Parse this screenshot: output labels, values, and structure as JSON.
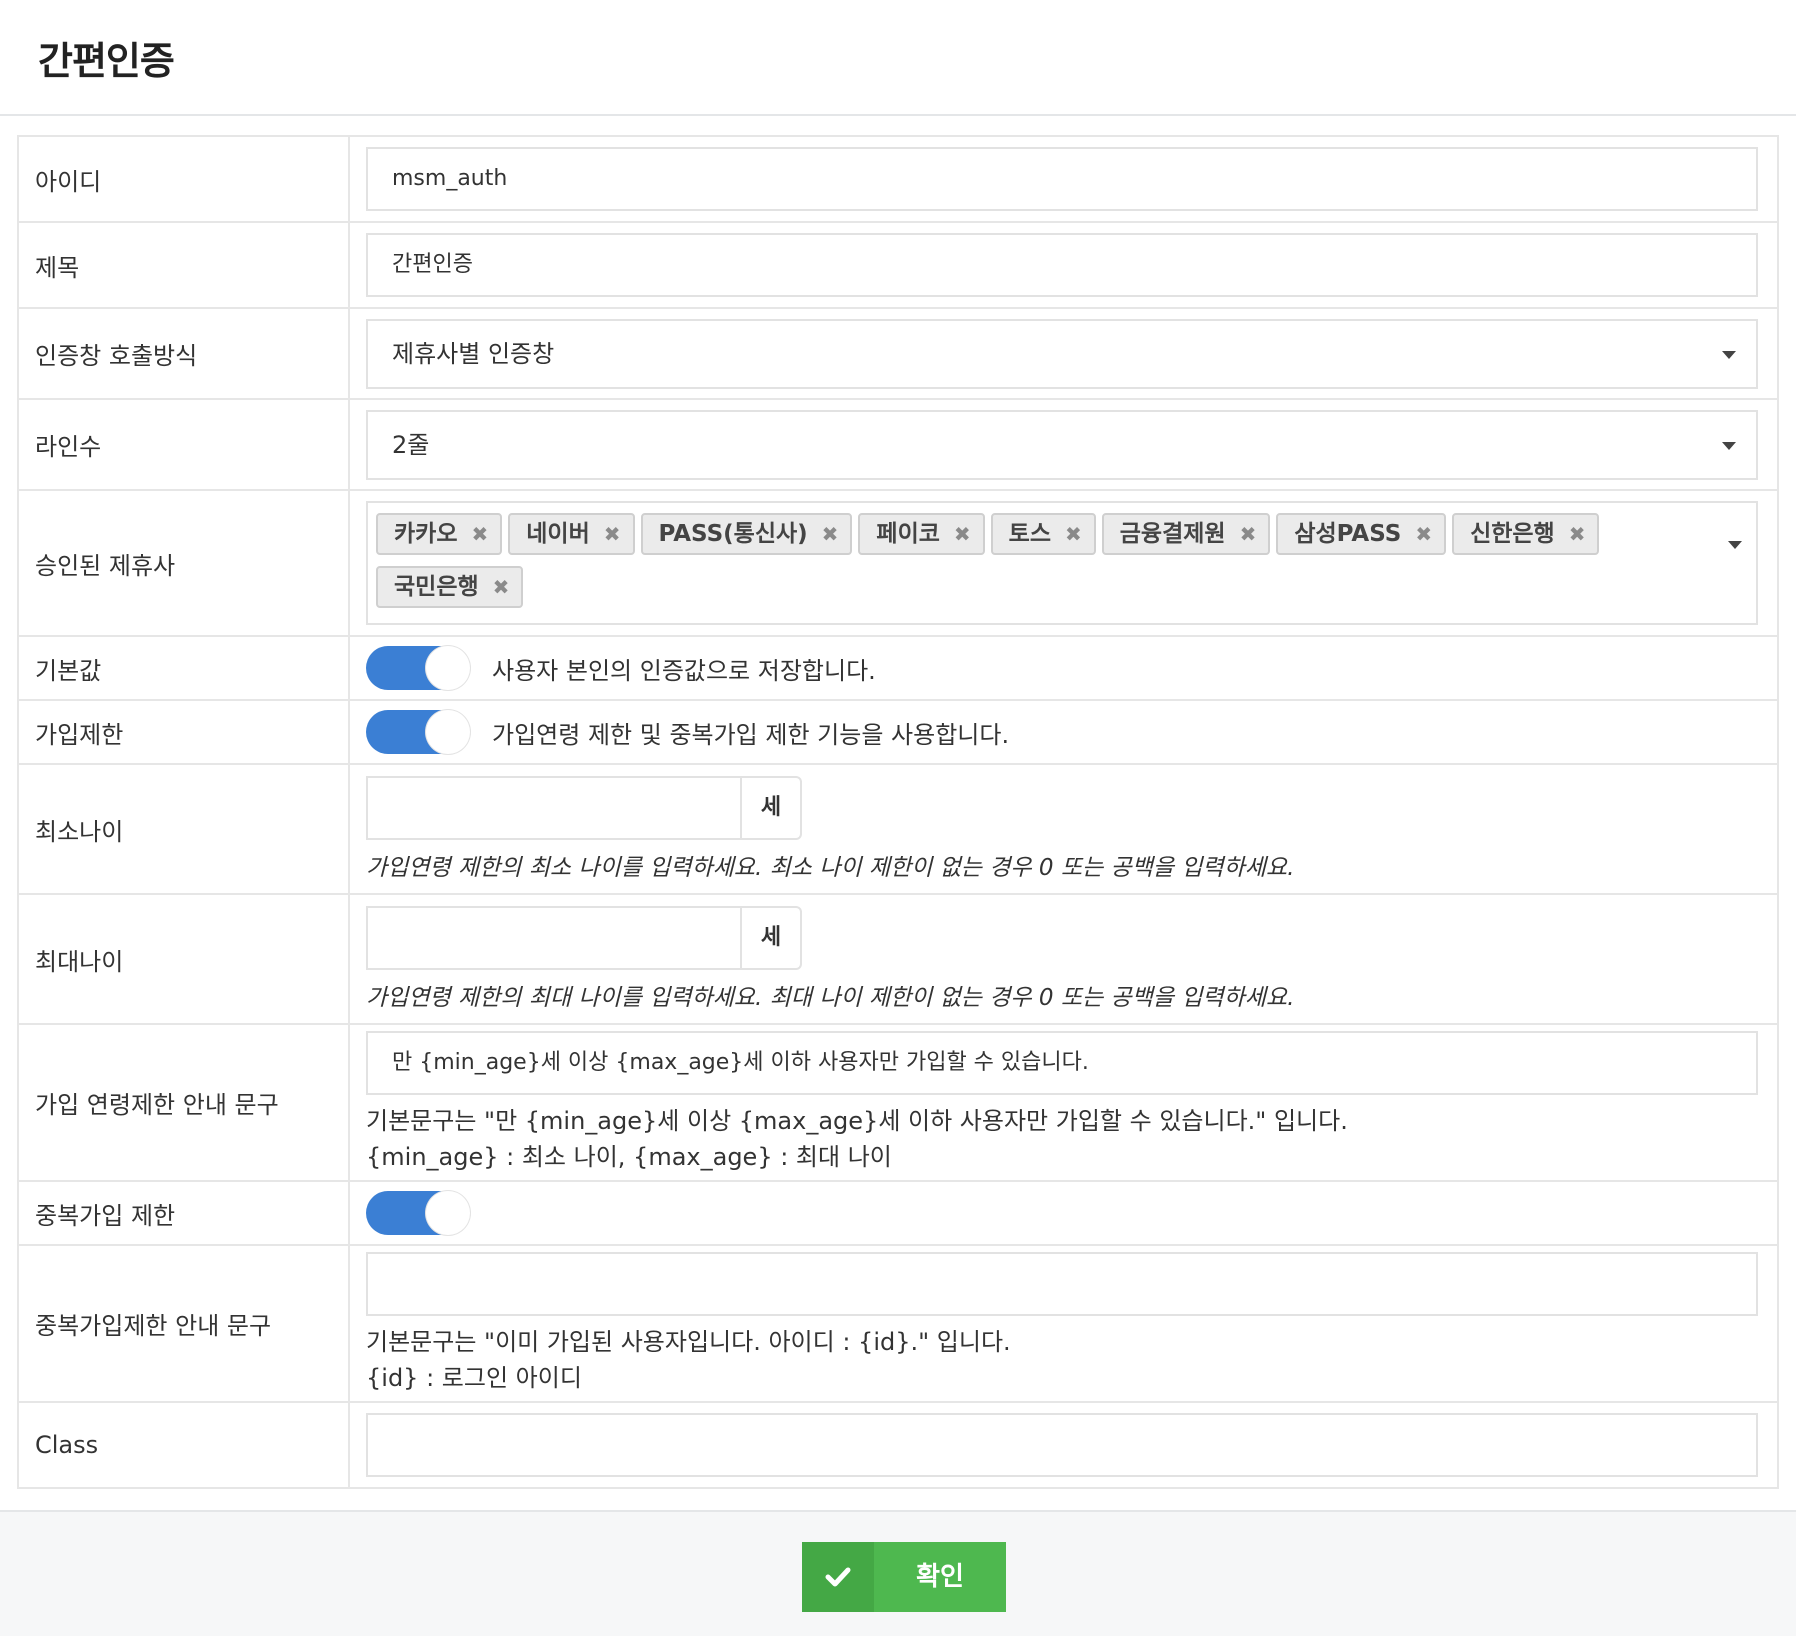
{
  "page": {
    "title": "간편인증"
  },
  "form": {
    "id": {
      "label": "아이디",
      "value": "msm_auth"
    },
    "title": {
      "label": "제목",
      "value": "간편인증"
    },
    "call_method": {
      "label": "인증창 호출방식",
      "value": "제휴사별 인증창"
    },
    "lines": {
      "label": "라인수",
      "value": "2줄"
    },
    "partners": {
      "label": "승인된 제휴사",
      "tags": [
        "카카오",
        "네이버",
        "PASS(통신사)",
        "페이코",
        "토스",
        "금융결제원",
        "삼성PASS",
        "신한은행",
        "국민은행"
      ],
      "remove_glyph": "✖"
    },
    "default": {
      "label": "기본값",
      "enabled": true,
      "text": "사용자 본인의 인증값으로 저장합니다."
    },
    "join_limit": {
      "label": "가입제한",
      "enabled": true,
      "text": "가입연령 제한 및 중복가입 제한 기능을 사용합니다."
    },
    "min_age": {
      "label": "최소나이",
      "value": "",
      "unit": "세",
      "help": "가입연령 제한의 최소 나이를 입력하세요. 최소 나이 제한이 없는 경우 0 또는 공백을 입력하세요."
    },
    "max_age": {
      "label": "최대나이",
      "value": "",
      "unit": "세",
      "help": "가입연령 제한의 최대 나이를 입력하세요. 최대 나이 제한이 없는 경우 0 또는 공백을 입력하세요."
    },
    "age_msg": {
      "label": "가입 연령제한 안내 문구",
      "value": "만 {min_age}세 이상 {max_age}세 이하 사용자만 가입할 수 있습니다.",
      "help1": "기본문구는 \"만 {min_age}세 이상 {max_age}세 이하 사용자만 가입할 수 있습니다.\" 입니다.",
      "help2": "{min_age} : 최소 나이, {max_age} : 최대 나이"
    },
    "dup_limit": {
      "label": "중복가입 제한",
      "enabled": true
    },
    "dup_msg": {
      "label": "중복가입제한 안내 문구",
      "value": "",
      "help1": "기본문구는 \"이미 가입된 사용자입니다. 아이디 : {id}.\" 입니다.",
      "help2": "{id} : 로그인 아이디"
    },
    "class": {
      "label": "Class",
      "value": ""
    }
  },
  "footer": {
    "confirm_label": "확인"
  },
  "colors": {
    "toggle_on": "#3b7fd4",
    "confirm_button": "#4eb84f"
  },
  "icons": {
    "confirm": "check-icon",
    "select": "caret-down-icon",
    "tag_remove": "remove-x-icon"
  }
}
